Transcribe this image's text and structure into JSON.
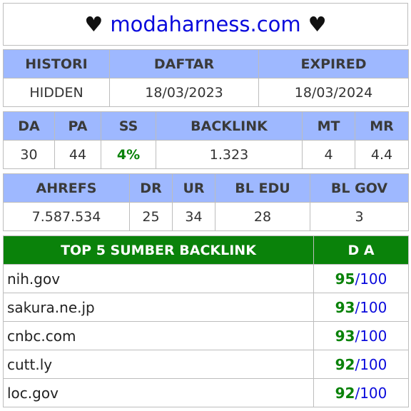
{
  "header": {
    "heart_left": "♥",
    "domain": "modaharness.com",
    "heart_right": "♥"
  },
  "registration": {
    "headers": [
      "HISTORI",
      "DAFTAR",
      "EXPIRED"
    ],
    "values": [
      "HIDDEN",
      "18/03/2023",
      "18/03/2024"
    ]
  },
  "metrics1": {
    "headers": [
      "DA",
      "PA",
      "SS",
      "BACKLINK",
      "MT",
      "MR"
    ],
    "values": [
      "30",
      "44",
      "4%",
      "1.323",
      "4",
      "4.4"
    ]
  },
  "metrics2": {
    "headers": [
      "AHREFS",
      "DR",
      "UR",
      "BL EDU",
      "BL GOV"
    ],
    "values": [
      "7.587.534",
      "25",
      "34",
      "28",
      "3"
    ]
  },
  "backlinks": {
    "header_source": "TOP 5 SUMBER BACKLINK",
    "header_da": "D A",
    "rows": [
      {
        "domain": "nih.gov",
        "da": "95",
        "max": "/100"
      },
      {
        "domain": "sakura.ne.jp",
        "da": "93",
        "max": "/100"
      },
      {
        "domain": "cnbc.com",
        "da": "93",
        "max": "/100"
      },
      {
        "domain": "cutt.ly",
        "da": "92",
        "max": "/100"
      },
      {
        "domain": "loc.gov",
        "da": "92",
        "max": "/100"
      }
    ]
  },
  "colors": {
    "header_blue": "#9eb8ff",
    "header_green": "#0a820a",
    "link_blue": "#0a0adc"
  }
}
